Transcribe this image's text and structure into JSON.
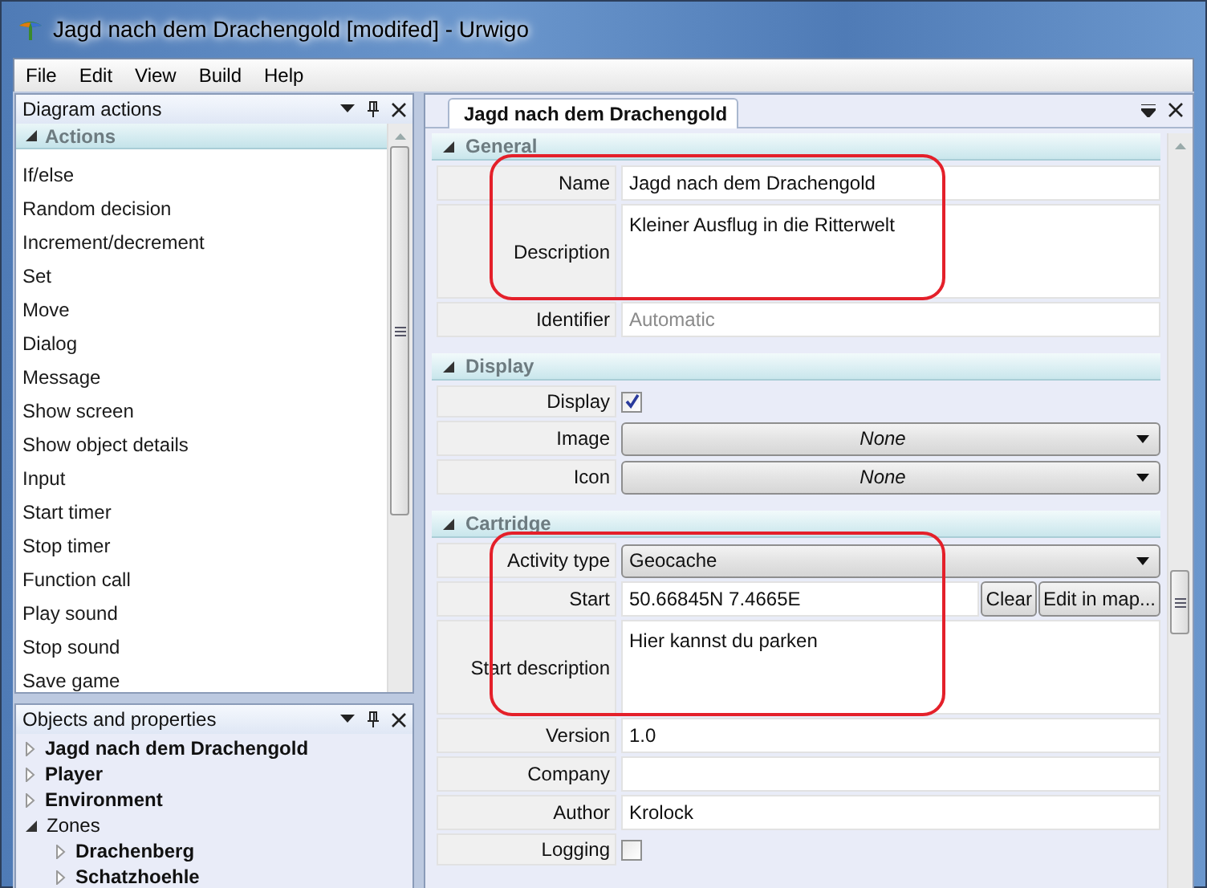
{
  "window": {
    "title": "Jagd nach dem Drachengold [modifed] - Urwigo"
  },
  "menu": [
    "File",
    "Edit",
    "View",
    "Build",
    "Help"
  ],
  "diagram_actions": {
    "title": "Diagram actions",
    "section": {
      "label": "Actions",
      "expanded": true
    },
    "items": [
      "If/else",
      "Random decision",
      "Increment/decrement",
      "Set",
      "Move",
      "Dialog",
      "Message",
      "Show screen",
      "Show object details",
      "Input",
      "Start timer",
      "Stop timer",
      "Function call",
      "Play sound",
      "Stop sound",
      "Save game"
    ]
  },
  "objects_panel": {
    "title": "Objects and properties",
    "tree": [
      {
        "label": "Jagd nach dem Drachengold",
        "bold": true,
        "expanded": false
      },
      {
        "label": "Player",
        "bold": true,
        "expanded": false
      },
      {
        "label": "Environment",
        "bold": true,
        "expanded": false
      },
      {
        "label": "Zones",
        "bold": false,
        "expanded": true,
        "children": [
          {
            "label": "Drachenberg",
            "bold": true,
            "expanded": false
          },
          {
            "label": "Schatzhoehle",
            "bold": true,
            "expanded": false
          }
        ]
      }
    ]
  },
  "editor": {
    "tab": {
      "label": "Jagd nach dem Drachengold",
      "selected": true
    },
    "sections": [
      {
        "label": "General",
        "expanded": true,
        "rows": [
          {
            "label": "Name",
            "kind": "text",
            "value": "Jagd nach dem Drachengold",
            "circled": true
          },
          {
            "label": "Description",
            "kind": "textarea",
            "value": "Kleiner Ausflug in die Ritterwelt",
            "circled": true
          },
          {
            "label": "Identifier",
            "kind": "text",
            "placeholder": "Automatic",
            "circled": false
          }
        ]
      },
      {
        "label": "Display",
        "expanded": true,
        "rows": [
          {
            "label": "Display",
            "kind": "checkbox",
            "checked": true,
            "circled": false
          },
          {
            "label": "Image",
            "kind": "combo",
            "value": "None",
            "is_default": true,
            "circled": false
          },
          {
            "label": "Icon",
            "kind": "combo",
            "value": "None",
            "is_default": true,
            "circled": false
          }
        ]
      },
      {
        "label": "Cartridge",
        "expanded": true,
        "rows": [
          {
            "label": "Activity type",
            "kind": "combo",
            "value": "Geocache",
            "is_default": false,
            "circled": true
          },
          {
            "label": "Start",
            "kind": "location",
            "value": "50.66845N 7.4665E",
            "buttons": [
              "Clear",
              "Edit in map..."
            ],
            "circled": true
          },
          {
            "label": "Start description",
            "kind": "textarea",
            "value": "Hier kannst du parken",
            "circled": true
          },
          {
            "label": "Version",
            "kind": "text",
            "value": "1.0",
            "circled": false
          },
          {
            "label": "Company",
            "kind": "text",
            "circled": false
          },
          {
            "label": "Author",
            "kind": "text",
            "value": "Krolock",
            "circled": false
          },
          {
            "label": "Logging",
            "kind": "checkbox",
            "checked": false,
            "circled": false
          }
        ]
      }
    ]
  }
}
